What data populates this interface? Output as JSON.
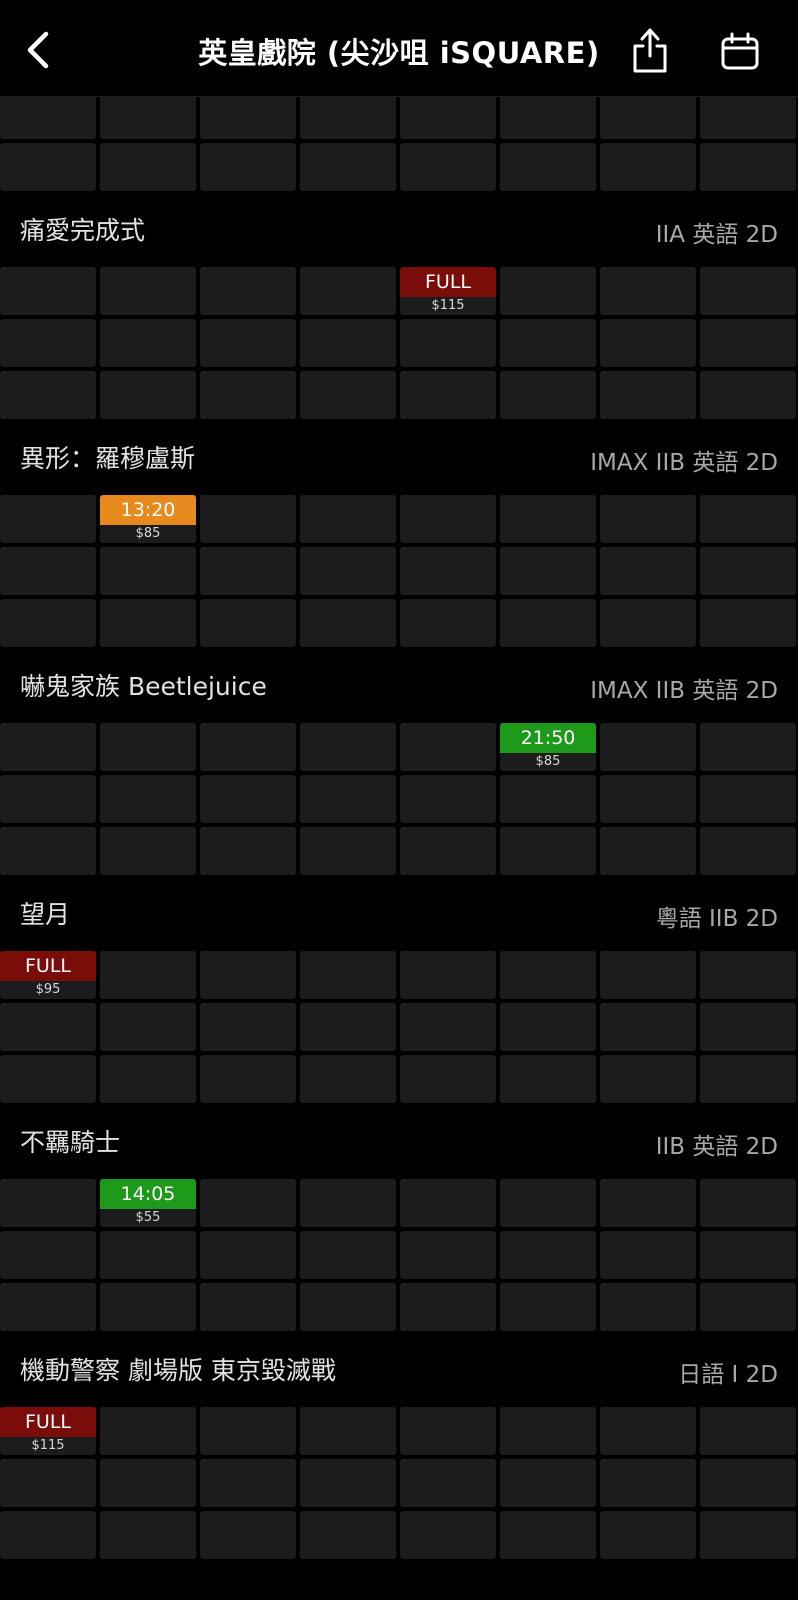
{
  "header": {
    "title": "英皇戲院 (尖沙咀 iSQUARE)",
    "back_icon": "chevron-left-icon",
    "share_icon": "share-icon",
    "calendar_icon": "calendar-icon"
  },
  "colors": {
    "full": "#7a0c0a",
    "limited": "#e68a1e",
    "available": "#1e9a1a",
    "cell": "#1c1c1c"
  },
  "movies": [
    {
      "title": "痛愛完成式",
      "meta": "IIA 英語 2D",
      "sessions": [
        {
          "row": 0,
          "col": 4,
          "label": "FULL",
          "price": "$115",
          "status": "full"
        }
      ]
    },
    {
      "title": "異形：羅穆盧斯",
      "meta": "IMAX IIB 英語 2D",
      "sessions": [
        {
          "row": 0,
          "col": 1,
          "label": "13:20",
          "price": "$85",
          "status": "limited"
        }
      ]
    },
    {
      "title": "嚇鬼家族 Beetlejuice",
      "meta": "IMAX IIB 英語 2D",
      "sessions": [
        {
          "row": 0,
          "col": 5,
          "label": "21:50",
          "price": "$85",
          "status": "available"
        }
      ]
    },
    {
      "title": "望月",
      "meta": "粵語 IIB 2D",
      "sessions": [
        {
          "row": 0,
          "col": 0,
          "label": "FULL",
          "price": "$95",
          "status": "full"
        }
      ]
    },
    {
      "title": "不羈騎士",
      "meta": "IIB 英語 2D",
      "sessions": [
        {
          "row": 0,
          "col": 1,
          "label": "14:05",
          "price": "$55",
          "status": "available"
        }
      ]
    },
    {
      "title": "機動警察 劇場版 東京毀滅戰",
      "meta": "日語 I 2D",
      "sessions": [
        {
          "row": 0,
          "col": 0,
          "label": "FULL",
          "price": "$115",
          "status": "full"
        }
      ]
    }
  ]
}
